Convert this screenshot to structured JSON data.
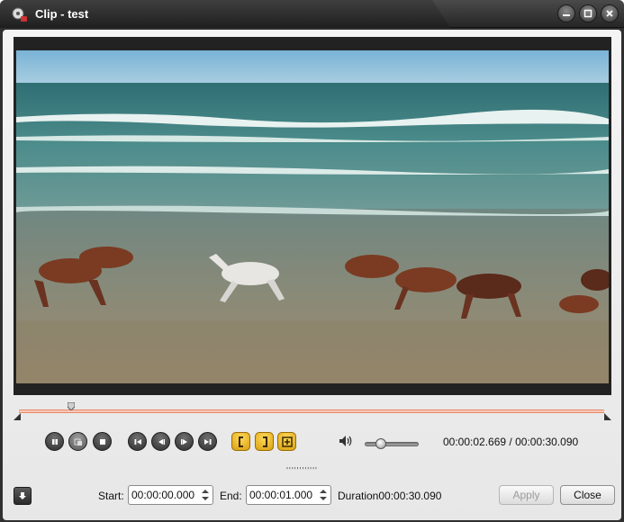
{
  "window": {
    "title": "Clip - test"
  },
  "player": {
    "time_current": "00:00:02.669",
    "time_total": "00:00:30.090",
    "time_separator": " / ",
    "progress": 0.0887,
    "volume": 0.3
  },
  "controls": {
    "play_pause": "pause-icon",
    "snapshot": "snapshot-icon",
    "stop": "stop-icon",
    "skip_start": "skip-to-start-icon",
    "step_back": "step-back-icon",
    "step_forward": "step-forward-icon",
    "skip_end": "skip-to-end-icon",
    "mark_in": "mark-in-icon",
    "mark_out": "mark-out-icon",
    "add_clip": "add-clip-icon"
  },
  "clip": {
    "start_label": "Start:",
    "start_value": "00:00:00.000",
    "end_label": "End:",
    "end_value": "00:00:01.000",
    "duration_label": "Duration",
    "duration_value": "00:00:30.090"
  },
  "buttons": {
    "apply": "Apply",
    "close": "Close"
  },
  "colors": {
    "accent_gold": "#f0b820",
    "timeline_track": "#e9896a",
    "frame": "#222222"
  }
}
